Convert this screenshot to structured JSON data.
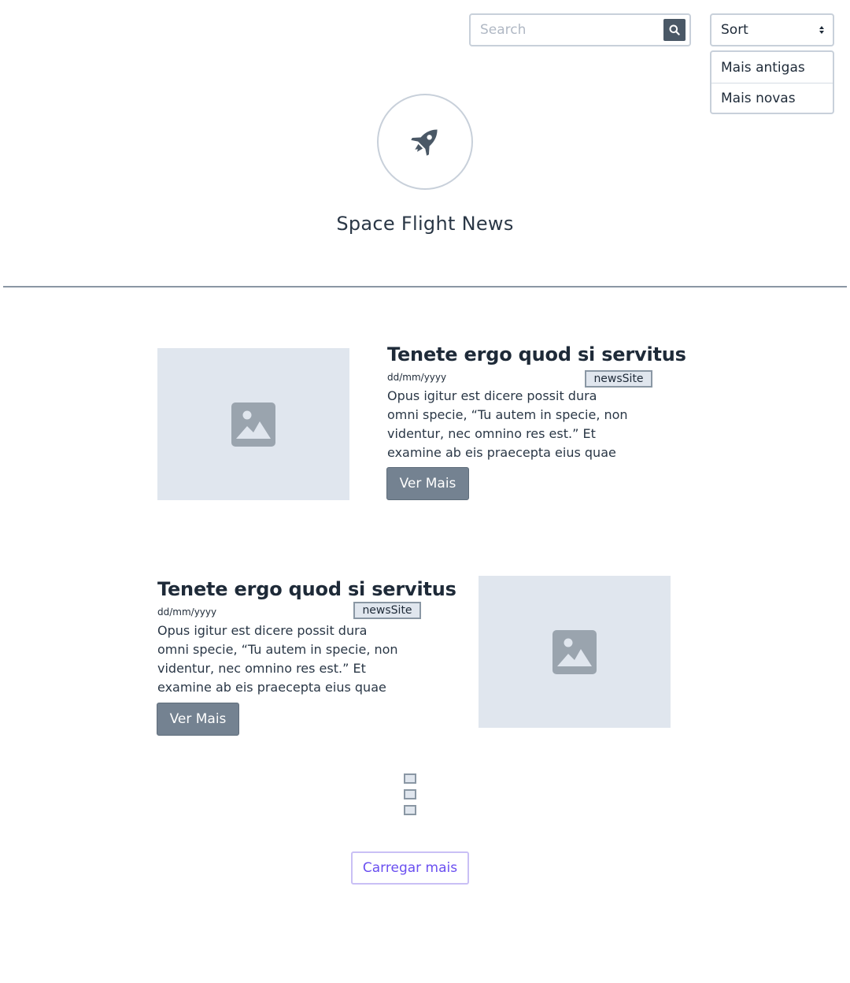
{
  "search": {
    "placeholder": "Search",
    "value": ""
  },
  "sort": {
    "selected": "Sort",
    "options": [
      "Mais antigas",
      "Mais novas"
    ]
  },
  "header": {
    "site_title": "Space Flight News"
  },
  "articles": [
    {
      "title": "Tenete ergo quod si servitus",
      "date": "dd/mm/yyyy",
      "site": "newsSite",
      "summary": "Opus igitur est dicere possit dura omni specie, “Tu autem in specie, non videntur, nec omnino res est.” Et examine ab eis praecepta eius quae",
      "button": "Ver Mais"
    },
    {
      "title": "Tenete ergo quod si servitus",
      "date": "dd/mm/yyyy",
      "site": "newsSite",
      "summary": "Opus igitur est dicere possit dura omni specie, “Tu autem in specie, non videntur, nec omnino res est.” Et examine ab eis praecepta eius quae",
      "button": "Ver Mais"
    }
  ],
  "load_more": {
    "label": "Carregar mais"
  },
  "icons": {
    "search": "search-icon",
    "sort": "sort-arrows-icon",
    "logo": "rocket-icon",
    "image_placeholder": "image-placeholder-icon"
  },
  "colors": {
    "primary_text": "#1e2a38",
    "button_bg": "#748291",
    "accent": "#6a4ff0",
    "placeholder_bg": "#e0e6ee"
  }
}
